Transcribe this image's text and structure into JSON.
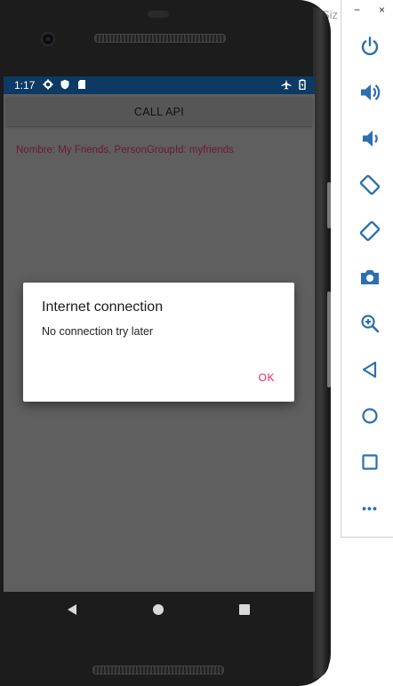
{
  "status_bar": {
    "time": "1:17"
  },
  "app": {
    "call_button_label": "CALL API",
    "result_text": "Nombre: My Friends, PersonGroupId: myfriends"
  },
  "dialog": {
    "title": "Internet connection",
    "message": "No connection try later",
    "ok_label": "OK"
  },
  "emulator": {
    "window_title_fragment": "Siz",
    "minimize_label": "−",
    "close_label": "×",
    "tools": [
      {
        "icon": "power-icon"
      },
      {
        "icon": "volume-up-icon"
      },
      {
        "icon": "volume-down-icon"
      },
      {
        "icon": "rotate-left-icon"
      },
      {
        "icon": "rotate-right-icon"
      },
      {
        "icon": "camera-icon"
      },
      {
        "icon": "zoom-icon"
      },
      {
        "icon": "back-icon"
      },
      {
        "icon": "home-icon"
      },
      {
        "icon": "overview-icon"
      },
      {
        "icon": "more-icon"
      }
    ],
    "more_label": "•••"
  },
  "colors": {
    "status_bar": "#0c3a64",
    "screen_bg": "#5f5f5f",
    "result_text": "#6a1930",
    "ok_accent": "#e6206a",
    "toolbar_icon": "#2c6fb0"
  }
}
